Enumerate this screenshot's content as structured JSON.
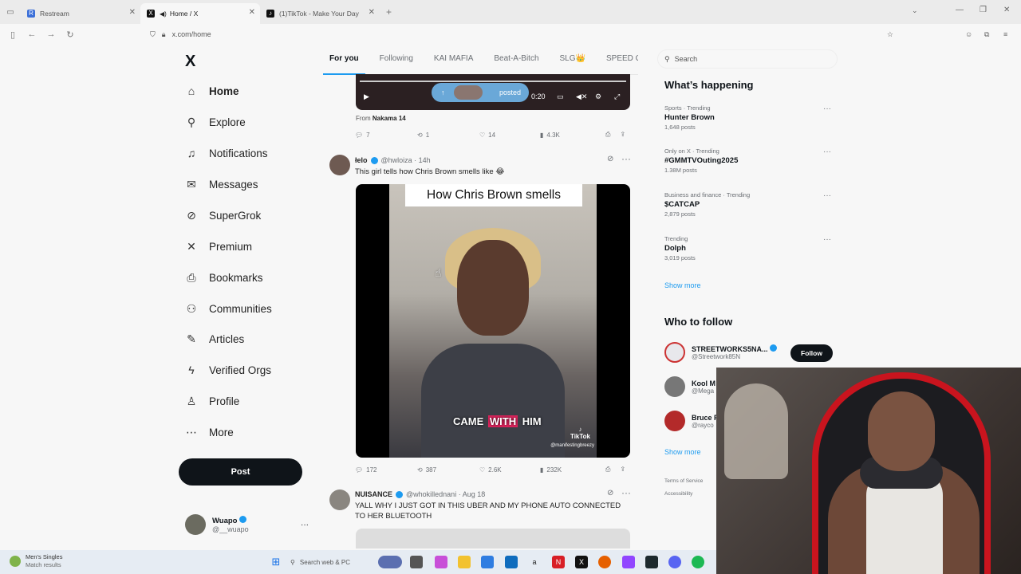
{
  "browser": {
    "tabs": [
      {
        "title": "Restream",
        "active": false
      },
      {
        "title": "Home / X",
        "active": true
      },
      {
        "title": "(1)TikTok - Make Your Day",
        "active": false
      }
    ],
    "url": "x.com/home",
    "new_tab": "+",
    "win_min": "—",
    "win_max": "❐",
    "win_close": "✕"
  },
  "nav": {
    "logo": "X",
    "items": [
      {
        "label": "Home",
        "icon": "home-icon",
        "glyph": "⌂"
      },
      {
        "label": "Explore",
        "icon": "search-icon",
        "glyph": "⚲"
      },
      {
        "label": "Notifications",
        "icon": "bell-icon",
        "glyph": "♫"
      },
      {
        "label": "Messages",
        "icon": "envelope-icon",
        "glyph": "✉"
      },
      {
        "label": "SuperGrok",
        "icon": "grok-icon",
        "glyph": "⊘"
      },
      {
        "label": "Premium",
        "icon": "x-icon",
        "glyph": "✕"
      },
      {
        "label": "Bookmarks",
        "icon": "bookmark-icon",
        "glyph": "⎙"
      },
      {
        "label": "Communities",
        "icon": "people-icon",
        "glyph": "⚇"
      },
      {
        "label": "Articles",
        "icon": "article-icon",
        "glyph": "✎"
      },
      {
        "label": "Verified Orgs",
        "icon": "lightning-icon",
        "glyph": "ϟ"
      },
      {
        "label": "Profile",
        "icon": "person-icon",
        "glyph": "♙"
      },
      {
        "label": "More",
        "icon": "more-circle-icon",
        "glyph": "⋯"
      }
    ],
    "post_label": "Post",
    "account": {
      "name": "Wuapo",
      "handle": "@__wuapo",
      "more": "···"
    }
  },
  "feed": {
    "tabs": [
      "For you",
      "Following",
      "KAI MAFIA",
      "Beat-A-Bitch",
      "SLG👑",
      "SPEED GAN"
    ],
    "top_video": {
      "posted_label": "posted",
      "time": "0:20",
      "from_label": "From",
      "from_name": "Nakama 14"
    },
    "top_actions": {
      "replies": "7",
      "reposts": "1",
      "likes": "14",
      "views": "4.3K"
    },
    "tweet1": {
      "name": "łelo",
      "handle": "@hwloiza · 14h",
      "text": "This girl tells how Chris Brown smells like 😂",
      "caption_top": "How Chris Brown smells",
      "caption_bottom_pre": "CAME ",
      "caption_bottom_hl": "WITH",
      "caption_bottom_post": " HIM",
      "tiktok": "TikTok",
      "tiktok_handle": "@manifestingbreezy",
      "actions": {
        "replies": "172",
        "reposts": "387",
        "likes": "2.6K",
        "views": "232K"
      }
    },
    "tweet2": {
      "name": "NUISANCE",
      "handle": "@whokillednani · Aug 18",
      "text": "YALL WHY I JUST GOT IN THIS UBER AND MY PHONE AUTO CONNECTED TO HER BLUETOOTH"
    }
  },
  "right": {
    "search_placeholder": "Search",
    "happening_title": "What’s happening",
    "trends": [
      {
        "category": "Sports · Trending",
        "title": "Hunter Brown",
        "count": "1,648 posts"
      },
      {
        "category": "Only on X · Trending",
        "title": "#GMMTVOuting2025",
        "count": "1.38M posts"
      },
      {
        "category": "Business and finance · Trending",
        "title": "$CATCAP",
        "count": "2,879 posts"
      },
      {
        "category": "Trending",
        "title": "Dolph",
        "count": "3,019 posts"
      }
    ],
    "show_more": "Show more",
    "follow_title": "Who to follow",
    "follow": [
      {
        "name": "STREETWORKS5NA...",
        "handle": "@Streetwork85N"
      },
      {
        "name": "Kool M",
        "handle": "@Mega"
      },
      {
        "name": "Bruce F",
        "handle": "@rayco"
      }
    ],
    "follow_btn": "Follow",
    "show_more_2": "Show more",
    "footer_terms": "Terms of Service",
    "footer_access": "Accessibility"
  },
  "taskbar": {
    "weather_title": "Men's Singles",
    "weather_sub": "Match results",
    "search_placeholder": "Search web & PC"
  }
}
